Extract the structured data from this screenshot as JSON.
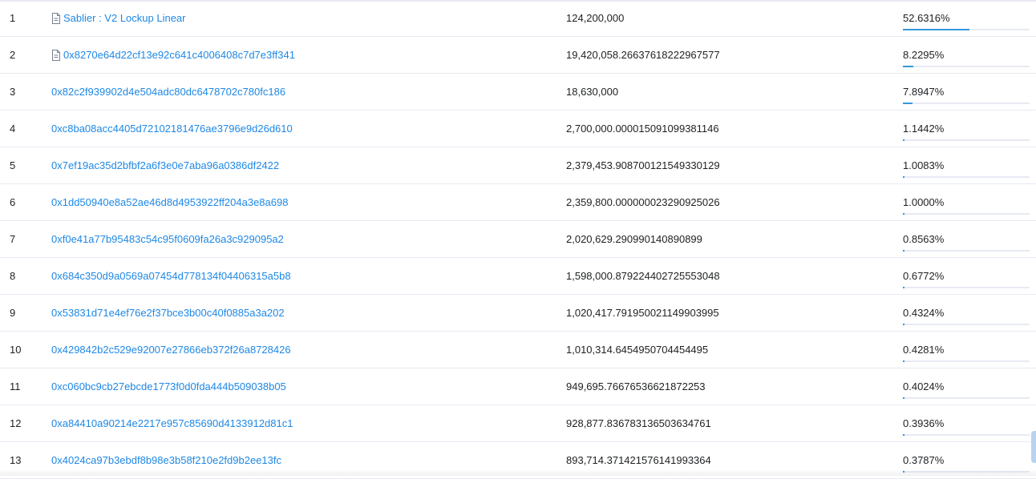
{
  "holders": {
    "rows": [
      {
        "rank": "1",
        "address": "Sablier : V2 Lockup Linear",
        "is_contract": true,
        "quantity": "124,200,000",
        "percentage": "52.6316%",
        "share": 52.6316
      },
      {
        "rank": "2",
        "address": "0x8270e64d22cf13e92c641c4006408c7d7e3ff341",
        "is_contract": true,
        "quantity": "19,420,058.26637618222967577",
        "percentage": "8.2295%",
        "share": 8.2295
      },
      {
        "rank": "3",
        "address": "0x82c2f939902d4e504adc80dc6478702c780fc186",
        "is_contract": false,
        "quantity": "18,630,000",
        "percentage": "7.8947%",
        "share": 7.8947
      },
      {
        "rank": "4",
        "address": "0xc8ba08acc4405d72102181476ae3796e9d26d610",
        "is_contract": false,
        "quantity": "2,700,000.000015091099381146",
        "percentage": "1.1442%",
        "share": 1.1442
      },
      {
        "rank": "5",
        "address": "0x7ef19ac35d2bfbf2a6f3e0e7aba96a0386df2422",
        "is_contract": false,
        "quantity": "2,379,453.908700121549330129",
        "percentage": "1.0083%",
        "share": 1.0083
      },
      {
        "rank": "6",
        "address": "0x1dd50940e8a52ae46d8d4953922ff204a3e8a698",
        "is_contract": false,
        "quantity": "2,359,800.000000023290925026",
        "percentage": "1.0000%",
        "share": 1.0
      },
      {
        "rank": "7",
        "address": "0xf0e41a77b95483c54c95f0609fa26a3c929095a2",
        "is_contract": false,
        "quantity": "2,020,629.290990140890899",
        "percentage": "0.8563%",
        "share": 0.8563
      },
      {
        "rank": "8",
        "address": "0x684c350d9a0569a07454d778134f04406315a5b8",
        "is_contract": false,
        "quantity": "1,598,000.879224402725553048",
        "percentage": "0.6772%",
        "share": 0.6772
      },
      {
        "rank": "9",
        "address": "0x53831d71e4ef76e2f37bce3b00c40f0885a3a202",
        "is_contract": false,
        "quantity": "1,020,417.791950021149903995",
        "percentage": "0.4324%",
        "share": 0.4324
      },
      {
        "rank": "10",
        "address": "0x429842b2c529e92007e27866eb372f26a8728426",
        "is_contract": false,
        "quantity": "1,010,314.6454950704454495",
        "percentage": "0.4281%",
        "share": 0.4281
      },
      {
        "rank": "11",
        "address": "0xc060bc9cb27ebcde1773f0d0fda444b509038b05",
        "is_contract": false,
        "quantity": "949,695.76676536621872253",
        "percentage": "0.4024%",
        "share": 0.4024
      },
      {
        "rank": "12",
        "address": "0xa84410a90214e2217e957c85690d4133912d81c1",
        "is_contract": false,
        "quantity": "928,877.836783136503634761",
        "percentage": "0.3936%",
        "share": 0.3936
      },
      {
        "rank": "13",
        "address": "0x4024ca97b3ebdf8b98e3b58f210e2fd9b2ee13fc",
        "is_contract": false,
        "quantity": "893,714.371421576141993364",
        "percentage": "0.3787%",
        "share": 0.3787
      }
    ]
  },
  "icons": {
    "contract": "file-document-icon"
  },
  "colors": {
    "link": "#1e88e5",
    "bar_fill": "#3498db",
    "bar_track": "#e7eaf3",
    "divider": "#e7eaf3"
  }
}
